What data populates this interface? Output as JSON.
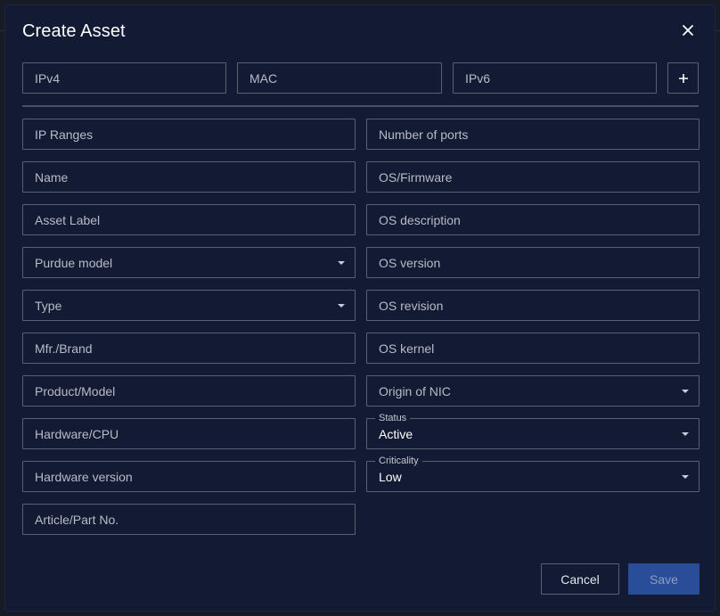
{
  "dialog": {
    "title": "Create Asset"
  },
  "network": {
    "ipv4_placeholder": "IPv4",
    "mac_placeholder": "MAC",
    "ipv6_placeholder": "IPv6",
    "add_icon": "plus-icon"
  },
  "left_fields": {
    "ip_ranges": "IP Ranges",
    "name": "Name",
    "asset_label": "Asset Label",
    "purdue_model": "Purdue model",
    "type": "Type",
    "mfr_brand": "Mfr./Brand",
    "product_model": "Product/Model",
    "hardware_cpu": "Hardware/CPU",
    "hardware_version": "Hardware version",
    "article_part_no": "Article/Part No."
  },
  "right_fields": {
    "number_of_ports": "Number of ports",
    "os_firmware": "OS/Firmware",
    "os_description": "OS description",
    "os_version": "OS version",
    "os_revision": "OS revision",
    "os_kernel": "OS kernel",
    "origin_of_nic": "Origin of NIC",
    "status_label": "Status",
    "status_value": "Active",
    "criticality_label": "Criticality",
    "criticality_value": "Low"
  },
  "actions": {
    "cancel_label": "Cancel",
    "save_label": "Save"
  },
  "colors": {
    "dialog_bg": "#131a33",
    "field_border": "#5a6171",
    "save_button_bg": "#2a4d9a",
    "text_primary": "#ffffff"
  }
}
